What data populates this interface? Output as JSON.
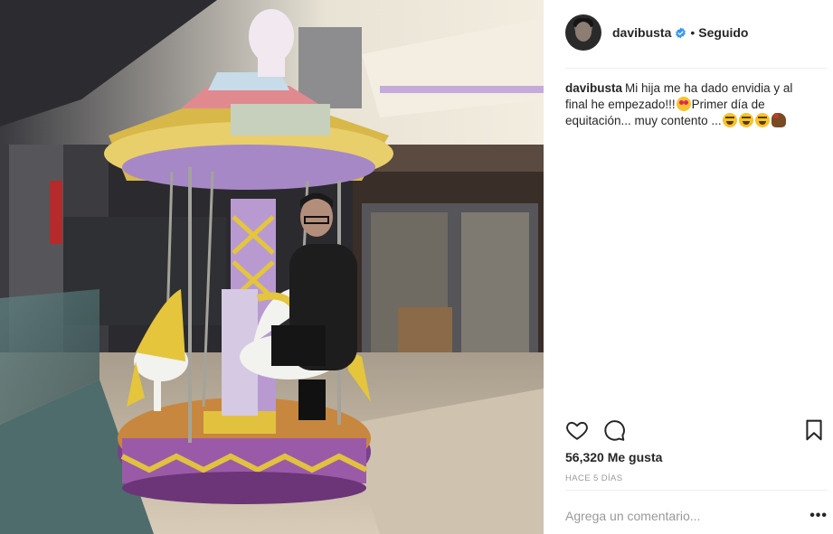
{
  "post": {
    "image_alt": "Hombre sentado en un caballo de carrusel infantil en un centro comercial",
    "colors": {
      "panel_bg": "#ffffff",
      "text": "#262626",
      "muted": "#999999",
      "verified": "#3897f0"
    }
  },
  "header": {
    "username": "davibusta",
    "verified_icon": "verified-badge-icon",
    "separator": "•",
    "follow_status": "Seguido"
  },
  "caption": {
    "username": "davibusta",
    "text_1": "Mi hija me ha dado envidia y al final he empezado!!!",
    "text_2": "Primer día de equitación... muy contento ...",
    "emoji_icons": [
      "heart-eyes-emoji-icon",
      "sweat-smile-emoji-icon",
      "sweat-smile-emoji-icon",
      "sweat-smile-emoji-icon",
      "horse-racing-emoji-icon"
    ]
  },
  "actions": {
    "like_icon": "heart-icon",
    "comment_icon": "comment-bubble-icon",
    "save_icon": "bookmark-icon"
  },
  "likes": "56,320 Me gusta",
  "timestamp": "HACE 5 DÍAS",
  "comment": {
    "placeholder": "Agrega un comentario...",
    "options_label": "•••"
  }
}
